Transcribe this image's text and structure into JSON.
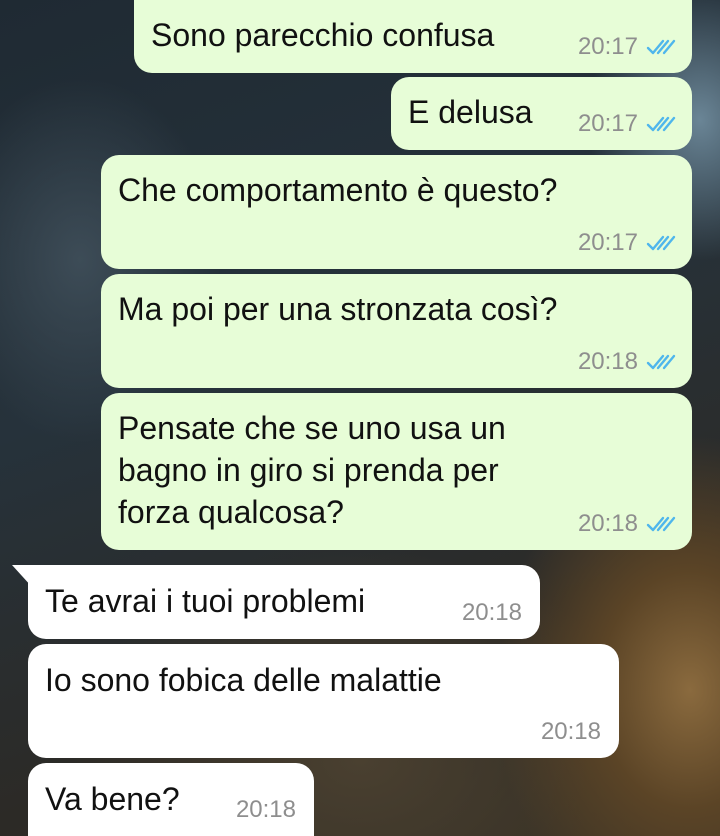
{
  "messages": [
    {
      "dir": "out",
      "text": "Sono parecchio confusa",
      "time": "20:17",
      "read_status_icon": "double-check-blue"
    },
    {
      "dir": "out",
      "text": "E delusa",
      "time": "20:17",
      "read_status_icon": "double-check-blue"
    },
    {
      "dir": "out",
      "text": "Che comportamento è questo?",
      "time": "20:17",
      "read_status_icon": "double-check-blue"
    },
    {
      "dir": "out",
      "text": "Ma poi per una stronzata così?",
      "time": "20:18",
      "read_status_icon": "double-check-blue"
    },
    {
      "dir": "out",
      "text": "Pensate che se uno usa un bagno in giro si prenda per forza qualcosa?",
      "time": "20:18",
      "read_status_icon": "double-check-blue"
    },
    {
      "dir": "in",
      "text": "Te avrai i tuoi problemi",
      "time": "20:18"
    },
    {
      "dir": "in",
      "text": "Io sono fobica delle malattie",
      "time": "20:18"
    },
    {
      "dir": "in",
      "text": "Va bene?",
      "time": "20:18"
    }
  ],
  "colors": {
    "outgoing_bubble": "#e7fdd7",
    "incoming_bubble": "#ffffff",
    "read_ticks": "#4fb6ec",
    "timestamp": "#8e8e8e"
  }
}
